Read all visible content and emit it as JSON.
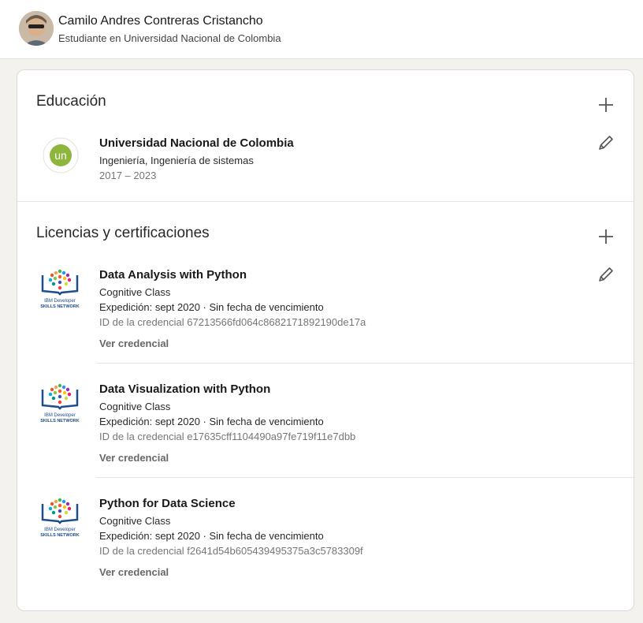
{
  "profile": {
    "name": "Camilo Andres Contreras Cristancho",
    "headline": "Estudiante en Universidad Nacional de Colombia"
  },
  "education": {
    "title": "Educación",
    "items": [
      {
        "school": "Universidad Nacional de Colombia",
        "degree": "Ingeniería, Ingeniería de sistemas",
        "dates": "2017 – 2023",
        "logo_text": "un",
        "logo_ring_text": "UNIVERSIDAD NACIONAL DE COLOMBIA"
      }
    ]
  },
  "certifications": {
    "title": "Licencias y certificaciones",
    "logo_lines": [
      "IBM Developer",
      "SKILLS NETWORK"
    ],
    "items": [
      {
        "name": "Data Analysis with Python",
        "issuer": "Cognitive Class",
        "issued": "Expedición: sept 2020 · Sin fecha de vencimiento",
        "credential_id": "ID de la credencial 67213566fd064c8682171892190de17a",
        "link": "Ver credencial"
      },
      {
        "name": "Data Visualization with Python",
        "issuer": "Cognitive Class",
        "issued": "Expedición: sept 2020 · Sin fecha de vencimiento",
        "credential_id": "ID de la credencial e17635cff1104490a97fe719f11e7dbb",
        "link": "Ver credencial"
      },
      {
        "name": "Python for Data Science",
        "issuer": "Cognitive Class",
        "issued": "Expedición: sept 2020 · Sin fecha de vencimiento",
        "credential_id": "ID de la credencial f2641d54b605439495375a3c5783309f",
        "link": "Ver credencial"
      }
    ]
  },
  "colors": {
    "unal_green": "#8cb63c",
    "ibm_blue": "#1f4e8c"
  }
}
